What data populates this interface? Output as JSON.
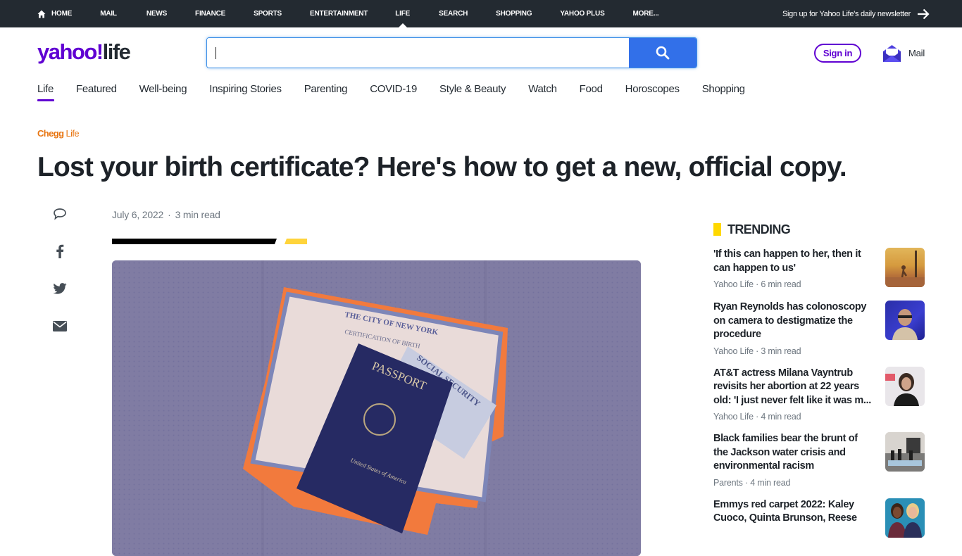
{
  "topnav": {
    "items": [
      {
        "label": "Home",
        "icon": "home-icon"
      },
      {
        "label": "Mail"
      },
      {
        "label": "News"
      },
      {
        "label": "Finance"
      },
      {
        "label": "Sports"
      },
      {
        "label": "Entertainment"
      },
      {
        "label": "Life",
        "active": true
      },
      {
        "label": "Search"
      },
      {
        "label": "Shopping"
      },
      {
        "label": "Yahoo Plus"
      },
      {
        "label": "More..."
      }
    ],
    "newsletter": "Sign up for Yahoo Life's daily newsletter",
    "newsletter_icon": "arrow-right-icon"
  },
  "header": {
    "logo_brand": "yahoo!",
    "logo_section": "life",
    "search": {
      "value": "",
      "placeholder": "",
      "button_icon": "search-icon"
    },
    "signin_label": "Sign in",
    "mail_label": "Mail",
    "accent_color": "#6001d2",
    "search_button_color": "#3270e9"
  },
  "subnav": {
    "tabs": [
      {
        "label": "Life",
        "active": true
      },
      {
        "label": "Featured"
      },
      {
        "label": "Well-being"
      },
      {
        "label": "Inspiring Stories"
      },
      {
        "label": "Parenting"
      },
      {
        "label": "COVID-19"
      },
      {
        "label": "Style & Beauty"
      },
      {
        "label": "Watch"
      },
      {
        "label": "Food"
      },
      {
        "label": "Horoscopes"
      },
      {
        "label": "Shopping"
      }
    ]
  },
  "article": {
    "provider_bold": "Chegg",
    "provider_thin": "Life",
    "headline": "Lost your birth certificate? Here's how to get a new, official copy.",
    "date": "July 6, 2022",
    "separator": "·",
    "read_time": "3 min read",
    "share_icons": [
      "comment-icon",
      "facebook-icon",
      "twitter-icon",
      "email-icon"
    ],
    "hero_image": {
      "description": "Passport, social security card and NYC birth certificate on a purple background",
      "passport_text": "PASSPORT",
      "passport_subtext": "United States of America",
      "certificate_header": "THE CITY OF NEW YORK",
      "certificate_subheader": "CERTIFICATION OF BIRTH",
      "card_text": "SOCIAL SECURITY"
    }
  },
  "trending": {
    "title": "TRENDING",
    "items": [
      {
        "title": "'If this can happen to her, then it can happen to us'",
        "source": "Yahoo Life",
        "read_time": "6 min read",
        "thumb": "autumn-runner"
      },
      {
        "title": "Ryan Reynolds has colonoscopy on camera to destigmatize the procedure",
        "source": "Yahoo Life",
        "read_time": "3 min read",
        "thumb": "ryan-reynolds"
      },
      {
        "title": "AT&T actress Milana Vayntrub revisits her abortion at 22 years old: 'I just never felt like it was m...",
        "source": "Yahoo Life",
        "read_time": "4 min read",
        "thumb": "milana-vayntrub"
      },
      {
        "title": "Black families bear the brunt of the Jackson water crisis and environmental racism",
        "source": "Parents",
        "read_time": "4 min read",
        "thumb": "jackson-water"
      },
      {
        "title": "Emmys red carpet 2022: Kaley Cuoco, Quinta Brunson, Reese",
        "source": "",
        "read_time": "",
        "thumb": "emmys-red-carpet"
      }
    ]
  }
}
